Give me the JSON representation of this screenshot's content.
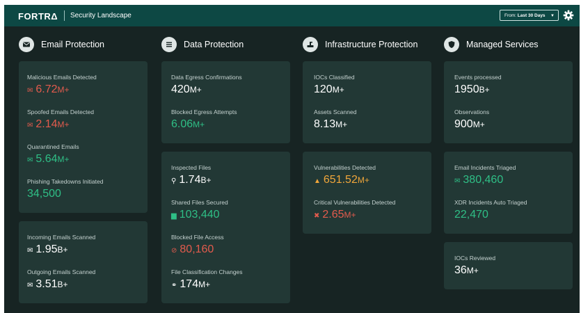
{
  "header": {
    "logo": "FORTRΔ",
    "title": "Security Landscape",
    "date_range": {
      "prefix": "From:",
      "value": "Last 30 Days"
    }
  },
  "columns": [
    {
      "title": "Email Protection",
      "icon": "envelope-icon"
    },
    {
      "title": "Data Protection",
      "icon": "list-icon"
    },
    {
      "title": "Infrastructure Protection",
      "icon": "server-icon"
    },
    {
      "title": "Managed Services",
      "icon": "shield-icon"
    }
  ],
  "metrics": {
    "malicious_emails": {
      "label": "Malicious Emails Detected",
      "value": "6.72",
      "unit": "M+",
      "color": "#e35b4d",
      "icon": "envelope-icon"
    },
    "spoofed_emails": {
      "label": "Spoofed Emails Detected",
      "value": "2.14",
      "unit": "M+",
      "color": "#e35b4d",
      "icon": "envelope-icon"
    },
    "quarantined_emails": {
      "label": "Quarantined Emails",
      "value": "5.64",
      "unit": "M+",
      "color": "#2fbf86",
      "icon": "envelope-icon"
    },
    "phishing_takedowns": {
      "label": "Phishing Takedowns Initiated",
      "value": "34,500",
      "unit": "",
      "color": "#2fbf86"
    },
    "incoming_emails": {
      "label": "Incoming Emails Scanned",
      "value": "1.95",
      "unit": "B+",
      "color": "#ffffff",
      "icon": "envelope-icon"
    },
    "outgoing_emails": {
      "label": "Outgoing Emails Scanned",
      "value": "3.51",
      "unit": "B+",
      "color": "#ffffff",
      "icon": "envelope-icon"
    },
    "egress_confirmations": {
      "label": "Data Egress Confirmations",
      "value": "420",
      "unit": "M+",
      "color": "#ffffff"
    },
    "blocked_egress": {
      "label": "Blocked Egress Attempts",
      "value": "6.06",
      "unit": "M+",
      "color": "#2fbf86"
    },
    "inspected_files": {
      "label": "Inspected Files",
      "value": "1.74",
      "unit": "B+",
      "color": "#ffffff",
      "icon": "search-icon"
    },
    "shared_files": {
      "label": "Shared Files Secured",
      "value": "103,440",
      "unit": "",
      "color": "#2fbf86",
      "icon": "file-icon"
    },
    "blocked_file_access": {
      "label": "Blocked File Access",
      "value": "80,160",
      "unit": "",
      "color": "#e35b4d",
      "icon": "blocked-icon"
    },
    "file_classification": {
      "label": "File Classification Changes",
      "value": "174",
      "unit": "M+",
      "color": "#ffffff",
      "icon": "link-icon"
    },
    "iocs_classified": {
      "label": "IOCs Classified",
      "value": "120",
      "unit": "M+",
      "color": "#ffffff"
    },
    "assets_scanned": {
      "label": "Assets Scanned",
      "value": "8.13",
      "unit": "M+",
      "color": "#ffffff"
    },
    "vulnerabilities": {
      "label": "Vulnerabilities Detected",
      "value": "651.52",
      "unit": "M+",
      "color": "#f0a63a",
      "icon": "warning-icon"
    },
    "critical_vulnerabilities": {
      "label": "Critical Vulnerabilities Detected",
      "value": "2.65",
      "unit": "M+",
      "color": "#e35b4d",
      "icon": "error-icon"
    },
    "events_processed": {
      "label": "Events processed",
      "value": "1950",
      "unit": "B+",
      "color": "#ffffff"
    },
    "observations": {
      "label": "Observations",
      "value": "900",
      "unit": "M+",
      "color": "#ffffff"
    },
    "email_incidents": {
      "label": "Email Incidents Triaged",
      "value": "380,460",
      "unit": "",
      "color": "#2fbf86",
      "icon": "envelope-icon"
    },
    "xdr_incidents": {
      "label": "XDR Incidents Auto Triaged",
      "value": "22,470",
      "unit": "",
      "color": "#2fbf86"
    },
    "iocs_reviewed": {
      "label": "IOCs Reviewed",
      "value": "36",
      "unit": "M+",
      "color": "#ffffff"
    }
  }
}
